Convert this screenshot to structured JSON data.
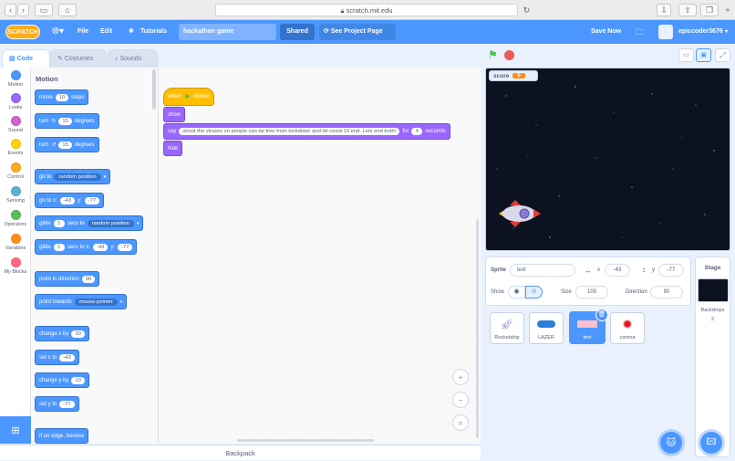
{
  "browser": {
    "url": "scratch.mit.edu"
  },
  "menu": {
    "logo": "SCRATCH",
    "file": "File",
    "edit": "Edit",
    "tutorials": "Tutorials",
    "project_title": "hackathon game",
    "share": "Shared",
    "see_project": "See Project Page",
    "save_now": "Save Now",
    "username": "epiccoder3676"
  },
  "tabs": {
    "code": "Code",
    "costumes": "Costumes",
    "sounds": "Sounds"
  },
  "categories": [
    {
      "label": "Motion",
      "color": "#4c97ff"
    },
    {
      "label": "Looks",
      "color": "#9966ff"
    },
    {
      "label": "Sound",
      "color": "#cf63cf"
    },
    {
      "label": "Events",
      "color": "#ffd500"
    },
    {
      "label": "Control",
      "color": "#ffab19"
    },
    {
      "label": "Sensing",
      "color": "#5cb1d6"
    },
    {
      "label": "Operators",
      "color": "#59c059"
    },
    {
      "label": "Variables",
      "color": "#ff8c1a"
    },
    {
      "label": "My Blocks",
      "color": "#ff6680"
    }
  ],
  "palette": {
    "heading": "Motion",
    "move": {
      "a": "move",
      "n": "10",
      "b": "steps"
    },
    "turn_cw": {
      "a": "turn",
      "n": "15",
      "b": "degrees"
    },
    "turn_ccw": {
      "a": "turn",
      "n": "15",
      "b": "degrees"
    },
    "goto": {
      "a": "go to",
      "dd": "random position"
    },
    "gotoxy": {
      "a": "go to x:",
      "x": "-43",
      "b": "y:",
      "y": "-77"
    },
    "glide_to": {
      "a": "glide",
      "n": "1",
      "b": "secs to",
      "dd": "random position"
    },
    "glide_xy": {
      "a": "glide",
      "n": "1",
      "b": "secs to x:",
      "x": "-43",
      "c": "y:",
      "y": "-77"
    },
    "point_dir": {
      "a": "point in direction",
      "n": "90"
    },
    "point_towards": {
      "a": "point towards",
      "dd": "mouse-pointer"
    },
    "change_x": {
      "a": "change x by",
      "n": "10"
    },
    "set_x": {
      "a": "set x to",
      "n": "-43"
    },
    "change_y": {
      "a": "change y by",
      "n": "10"
    },
    "set_y": {
      "a": "set y to",
      "n": "-77"
    },
    "bounce": {
      "a": "if on edge, bounce"
    }
  },
  "script": {
    "when_flag": {
      "a": "when",
      "b": "clicked"
    },
    "show": "show",
    "say": {
      "a": "say",
      "text": "shoot the viruses so people can be free from lockdown and let covid-19 end. Lets end both!",
      "b": "for",
      "n": "4",
      "c": "seconds"
    },
    "hide": "hide"
  },
  "zoom": {
    "in": "+",
    "out": "−",
    "reset": "="
  },
  "backpack": "Backpack",
  "stage": {
    "monitor_label": "score",
    "monitor_value": "0"
  },
  "sprite_info": {
    "sprite_label": "Sprite",
    "sprite_name": "text",
    "x_label": "x",
    "x_value": "-43",
    "y_label": "y",
    "y_value": "-77",
    "show_label": "Show",
    "size_label": "Size",
    "size_value": "100",
    "direction_label": "Direction",
    "direction_value": "90"
  },
  "sprites": [
    {
      "name": "Rocketship"
    },
    {
      "name": "LAZER"
    },
    {
      "name": "text"
    },
    {
      "name": "corona"
    }
  ],
  "stage_pane": {
    "title": "Stage",
    "backdrops_label": "Backdrops",
    "backdrops_count": "2"
  }
}
